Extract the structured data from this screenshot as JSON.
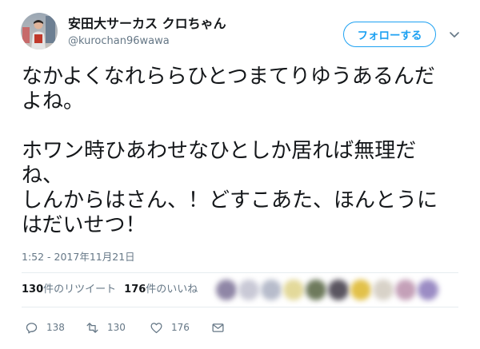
{
  "tweet": {
    "author": {
      "display_name": "安田大サーカス クロちゃん",
      "handle": "@kurochan96wawa",
      "avatar_icon": "profile-photo"
    },
    "follow_button": {
      "label": "フォローする"
    },
    "menu_icon": "chevron-down-icon",
    "body": {
      "paragraphs": [
        [
          "なかよくなれららひとつまてりゆうあるんだ",
          "よね。"
        ],
        [
          "ホワン時ひあわせなひとしか居れば無理だ",
          "ね、",
          "しんからはさん、！どすこあた、ほんとうに",
          "はだいせつ！"
        ]
      ]
    },
    "timestamp": "1:52 - 2017年11月21日",
    "stats": {
      "retweets": {
        "count": "130",
        "label": "件のリツイート"
      },
      "likes": {
        "count": "176",
        "label": "件のいいね"
      },
      "liker_avatar_colors": [
        "#8f86a6",
        "#c9c9d6",
        "#b7bccb",
        "#e3d99a",
        "#6e7a5c",
        "#5a5560",
        "#e2c14a",
        "#d8d2c8",
        "#c4a0b8",
        "#9b8cc4"
      ]
    },
    "actions": {
      "reply": {
        "icon": "reply-icon",
        "count": "138"
      },
      "retweet": {
        "icon": "retweet-icon",
        "count": "130"
      },
      "like": {
        "icon": "heart-icon",
        "count": "176"
      },
      "message": {
        "icon": "mail-icon"
      }
    }
  },
  "colors": {
    "accent": "#1da1f2",
    "text": "#14171a",
    "secondary": "#657786",
    "divider": "#e6ecf0",
    "background": "#ffffff"
  }
}
